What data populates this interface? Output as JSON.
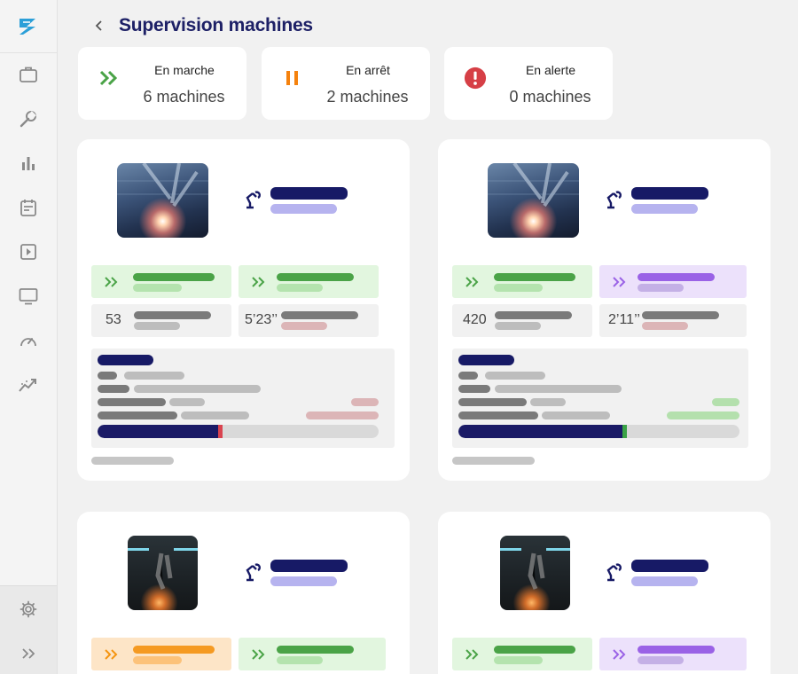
{
  "header": {
    "title": "Supervision machines"
  },
  "colors": {
    "title": "#1d2066",
    "running": "#4aa347",
    "stopped": "#f5820d",
    "alert": "#d63f46",
    "ink": "#171a66",
    "progress_end_red": "#d9434f",
    "progress_end_green": "#3aa346"
  },
  "sidebar": {
    "icons": [
      "logo-icon",
      "briefcase-icon",
      "wrench-icon",
      "bar-chart-icon",
      "calendar-icon",
      "play-icon",
      "monitor-icon",
      "gauge-icon",
      "trend-icon"
    ],
    "bottom_icons": [
      "gear-icon",
      "expand-icon"
    ]
  },
  "status_cards": [
    {
      "label": "En marche",
      "count": "6 machines",
      "icon": "running-chevrons-icon"
    },
    {
      "label": "En arrêt",
      "count": "2 machines",
      "icon": "pause-icon"
    },
    {
      "label": "En alerte",
      "count": "0 machines",
      "icon": "alert-icon"
    }
  ],
  "machines": [
    {
      "counter": "53",
      "duration": "5’23’’",
      "state_left": "running",
      "state_right": "running",
      "progress": 0.44
    },
    {
      "counter": "420",
      "duration": "2’11’’",
      "state_left": "running",
      "state_right": "purple",
      "progress": 0.6
    },
    {
      "state_left": "orange",
      "state_right": "running"
    },
    {
      "state_left": "running",
      "state_right": "purple"
    }
  ]
}
